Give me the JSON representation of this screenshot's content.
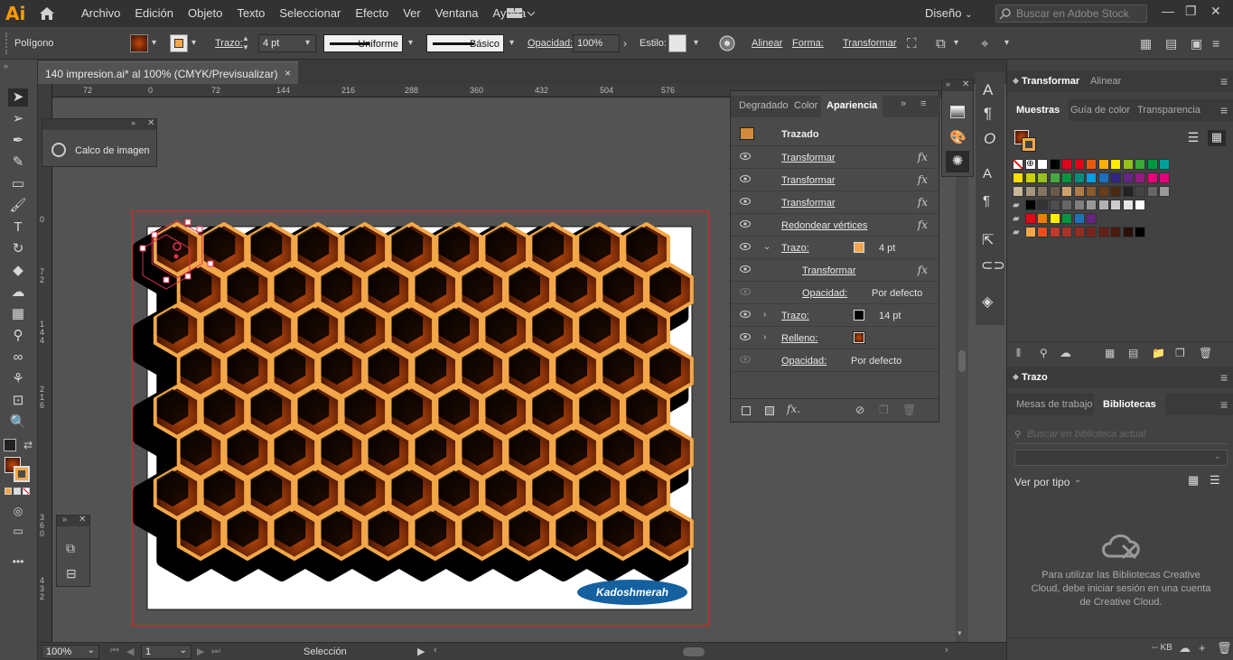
{
  "app": {
    "logo": "Ai"
  },
  "menu": [
    "Archivo",
    "Edición",
    "Objeto",
    "Texto",
    "Seleccionar",
    "Efecto",
    "Ver",
    "Ventana",
    "Ayuda"
  ],
  "workspace": "Diseño",
  "stock_search_placeholder": "Buscar en Adobe Stock",
  "control": {
    "object_type": "Polígono",
    "stroke_label": "Trazo:",
    "stroke_weight": "4 pt",
    "profile": "Uniforme",
    "brush": "Básico",
    "opacity_label": "Opacidad:",
    "opacity": "100%",
    "style_label": "Estilo:",
    "align": "Alinear",
    "shape": "Forma:",
    "transform": "Transformar"
  },
  "document": {
    "tab_title": "140 impresion.ai* al 100% (CMYK/Previsualizar)",
    "close": "×"
  },
  "ruler_h": [
    "72",
    "0",
    "72",
    "144",
    "216",
    "288",
    "360",
    "432",
    "504",
    "576"
  ],
  "ruler_v": [
    "0",
    "7\n2",
    "1\n4\n4",
    "2\n1\n6",
    "3\n6\n0",
    "4\n3\n2"
  ],
  "calco": {
    "title": "Calco de imagen"
  },
  "appearance": {
    "tabs": [
      "Degradado",
      "Color",
      "Apariencia"
    ],
    "header": "Trazado",
    "rows": [
      {
        "label": "Transformar",
        "value": "",
        "fx": "fx"
      },
      {
        "label": "Transformar",
        "value": "",
        "fx": "fx"
      },
      {
        "label": "Transformar",
        "value": "",
        "fx": "fx"
      },
      {
        "label": "Redondear vértices",
        "value": "",
        "fx": "fx"
      },
      {
        "label": "Trazo:",
        "value": "4 pt",
        "fx": ""
      },
      {
        "label": "Transformar",
        "value": "",
        "fx": "fx"
      },
      {
        "label": "Opacidad:",
        "value": "Por defecto",
        "fx": ""
      },
      {
        "label": "Trazo:",
        "value": "14 pt",
        "fx": ""
      },
      {
        "label": "Relleno:",
        "value": "",
        "fx": ""
      },
      {
        "label": "Opacidad:",
        "value": "Por defecto",
        "fx": ""
      }
    ],
    "footer_fx": "fx."
  },
  "right": {
    "top_tabs": [
      "Transformar",
      "Alinear"
    ],
    "swatch_tabs": [
      "Muestras",
      "Guía de color",
      "Transparencia"
    ],
    "stroke_panel": "Trazo",
    "lib_tabs": [
      "Mesas de trabajo",
      "Bibliotecas"
    ],
    "lib_search_placeholder": "Buscar en biblioteca actual",
    "view_by": "Ver por tipo",
    "cc_message": "Para utilizar las Bibliotecas Creative Cloud, debe iniciar sesión en una cuenta de Creative Cloud.",
    "kb": "-- KB"
  },
  "status": {
    "zoom": "100%",
    "artboard": "1",
    "tool": "Selección"
  },
  "artwork": {
    "watermark": "Kadoshmerah"
  },
  "colors": {
    "bg": "#535353",
    "accent": "#f2a849",
    "honey": "#8a3a0a",
    "stroke_orange": "#f2a849",
    "watermark_blue": "#1561a0"
  }
}
